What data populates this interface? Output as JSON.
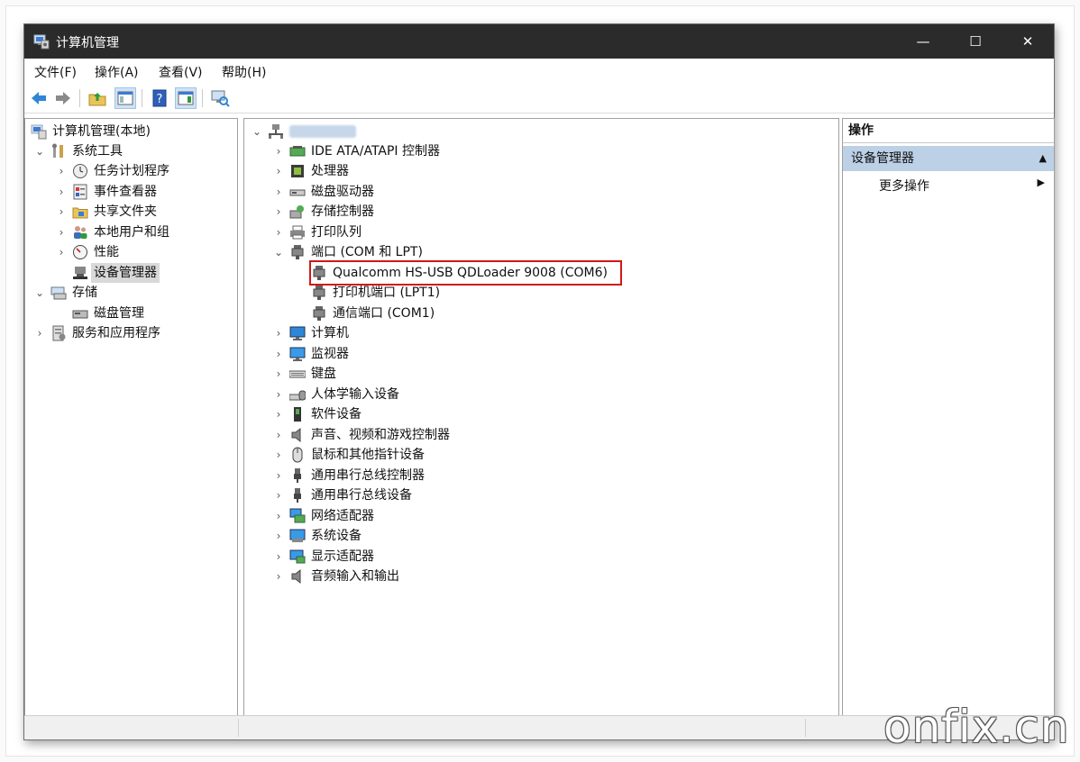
{
  "window": {
    "title": "计算机管理",
    "icon": "computer-management-icon"
  },
  "menu": [
    "文件(F)",
    "操作(A)",
    "查看(V)",
    "帮助(H)"
  ],
  "left_tree": [
    {
      "label": "计算机管理(本地)",
      "icon": "computer-management-icon",
      "level": 0,
      "chevron": "",
      "selected": false
    },
    {
      "label": "系统工具",
      "icon": "tools-icon",
      "level": 1,
      "chevron": "expanded",
      "selected": false
    },
    {
      "label": "任务计划程序",
      "icon": "clock-icon",
      "level": 2,
      "chevron": "collapsed",
      "selected": false
    },
    {
      "label": "事件查看器",
      "icon": "event-viewer-icon",
      "level": 2,
      "chevron": "collapsed",
      "selected": false
    },
    {
      "label": "共享文件夹",
      "icon": "shared-folder-icon",
      "level": 2,
      "chevron": "collapsed",
      "selected": false
    },
    {
      "label": "本地用户和组",
      "icon": "users-icon",
      "level": 2,
      "chevron": "collapsed",
      "selected": false
    },
    {
      "label": "性能",
      "icon": "performance-icon",
      "level": 2,
      "chevron": "collapsed",
      "selected": false
    },
    {
      "label": "设备管理器",
      "icon": "device-manager-icon",
      "level": 2,
      "chevron": "",
      "selected": true
    },
    {
      "label": "存储",
      "icon": "storage-icon",
      "level": 1,
      "chevron": "expanded",
      "selected": false
    },
    {
      "label": "磁盘管理",
      "icon": "disk-management-icon",
      "level": 2,
      "chevron": "",
      "selected": false
    },
    {
      "label": "服务和应用程序",
      "icon": "services-icon",
      "level": 1,
      "chevron": "collapsed",
      "selected": false
    }
  ],
  "device_tree": [
    {
      "label": "",
      "icon": "computer-network-icon",
      "level": 0,
      "chevron": "expanded",
      "blurred": true
    },
    {
      "label": "IDE ATA/ATAPI 控制器",
      "icon": "ide-controller-icon",
      "level": 1,
      "chevron": "collapsed"
    },
    {
      "label": "处理器",
      "icon": "processor-icon",
      "level": 1,
      "chevron": "collapsed"
    },
    {
      "label": "磁盘驱动器",
      "icon": "disk-drive-icon",
      "level": 1,
      "chevron": "collapsed"
    },
    {
      "label": "存储控制器",
      "icon": "storage-controller-icon",
      "level": 1,
      "chevron": "collapsed"
    },
    {
      "label": "打印队列",
      "icon": "printer-icon",
      "level": 1,
      "chevron": "collapsed"
    },
    {
      "label": "端口 (COM 和 LPT)",
      "icon": "port-icon",
      "level": 1,
      "chevron": "expanded"
    },
    {
      "label": "Qualcomm HS-USB QDLoader 9008 (COM6)",
      "icon": "port-icon",
      "level": 2,
      "chevron": "",
      "highlighted": true
    },
    {
      "label": "打印机端口 (LPT1)",
      "icon": "port-icon",
      "level": 2,
      "chevron": ""
    },
    {
      "label": "通信端口 (COM1)",
      "icon": "port-icon",
      "level": 2,
      "chevron": ""
    },
    {
      "label": "计算机",
      "icon": "monitor-icon",
      "level": 1,
      "chevron": "collapsed"
    },
    {
      "label": "监视器",
      "icon": "monitor-icon",
      "level": 1,
      "chevron": "collapsed"
    },
    {
      "label": "键盘",
      "icon": "keyboard-icon",
      "level": 1,
      "chevron": "collapsed"
    },
    {
      "label": "人体学输入设备",
      "icon": "hid-icon",
      "level": 1,
      "chevron": "collapsed"
    },
    {
      "label": "软件设备",
      "icon": "software-device-icon",
      "level": 1,
      "chevron": "collapsed"
    },
    {
      "label": "声音、视频和游戏控制器",
      "icon": "speaker-icon",
      "level": 1,
      "chevron": "collapsed"
    },
    {
      "label": "鼠标和其他指针设备",
      "icon": "mouse-icon",
      "level": 1,
      "chevron": "collapsed"
    },
    {
      "label": "通用串行总线控制器",
      "icon": "usb-icon",
      "level": 1,
      "chevron": "collapsed"
    },
    {
      "label": "通用串行总线设备",
      "icon": "usb-icon",
      "level": 1,
      "chevron": "collapsed"
    },
    {
      "label": "网络适配器",
      "icon": "network-adapter-icon",
      "level": 1,
      "chevron": "collapsed"
    },
    {
      "label": "系统设备",
      "icon": "system-device-icon",
      "level": 1,
      "chevron": "collapsed"
    },
    {
      "label": "显示适配器",
      "icon": "display-adapter-icon",
      "level": 1,
      "chevron": "collapsed"
    },
    {
      "label": "音频输入和输出",
      "icon": "speaker-icon",
      "level": 1,
      "chevron": "collapsed"
    }
  ],
  "actions": {
    "header": "操作",
    "section": "设备管理器",
    "more": "更多操作"
  },
  "watermark": "onfix.cn",
  "colors": {
    "titlebar": "#2b2b2b",
    "selection_gray": "#d9d9d9",
    "actions_section": "#bcd0e6",
    "highlight_red": "#d01818"
  }
}
